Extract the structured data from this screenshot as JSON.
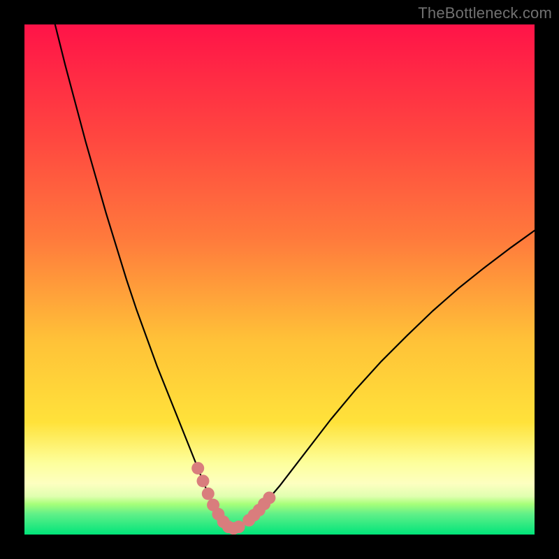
{
  "watermark": "TheBottleneck.com",
  "colors": {
    "bg": "#000000",
    "curve": "#000000",
    "marker": "#d97d7d",
    "grad_top": "#ff1348",
    "grad_mid1": "#ff7a3c",
    "grad_mid2": "#ffe23a",
    "grad_band_light": "#fdff9c",
    "grad_band_green_light": "#a8ff7a",
    "grad_bottom": "#00e47a"
  },
  "chart_data": {
    "type": "line",
    "title": "",
    "xlabel": "",
    "ylabel": "",
    "xlim": [
      0,
      100
    ],
    "ylim": [
      0,
      100
    ],
    "curve": {
      "name": "bottleneck-curve",
      "x": [
        6,
        8,
        10,
        12,
        14,
        16,
        18,
        20,
        22,
        24,
        26,
        28,
        30,
        32,
        33,
        34,
        35,
        36,
        37,
        38,
        39,
        40,
        41,
        42,
        44,
        46,
        50,
        55,
        60,
        65,
        70,
        75,
        80,
        85,
        90,
        95,
        100
      ],
      "y": [
        100,
        92,
        84.5,
        77,
        70,
        63,
        56.5,
        50,
        44,
        38.5,
        33,
        28,
        23,
        18,
        15.5,
        13,
        10.5,
        8,
        5.8,
        4,
        2.5,
        1.5,
        1.2,
        1.5,
        2.8,
        4.8,
        9.5,
        16,
        22.5,
        28.5,
        34,
        39,
        43.8,
        48.2,
        52.2,
        56,
        59.6
      ]
    },
    "markers": {
      "name": "highlight-points",
      "points": [
        {
          "x": 34,
          "y": 13
        },
        {
          "x": 35,
          "y": 10.5
        },
        {
          "x": 36,
          "y": 8
        },
        {
          "x": 37,
          "y": 5.8
        },
        {
          "x": 38,
          "y": 4
        },
        {
          "x": 39,
          "y": 2.5
        },
        {
          "x": 40,
          "y": 1.5
        },
        {
          "x": 41,
          "y": 1.2
        },
        {
          "x": 42,
          "y": 1.5
        },
        {
          "x": 44,
          "y": 2.8
        },
        {
          "x": 45,
          "y": 3.8
        },
        {
          "x": 46,
          "y": 4.8
        },
        {
          "x": 47,
          "y": 6.0
        },
        {
          "x": 48,
          "y": 7.2
        }
      ]
    }
  }
}
